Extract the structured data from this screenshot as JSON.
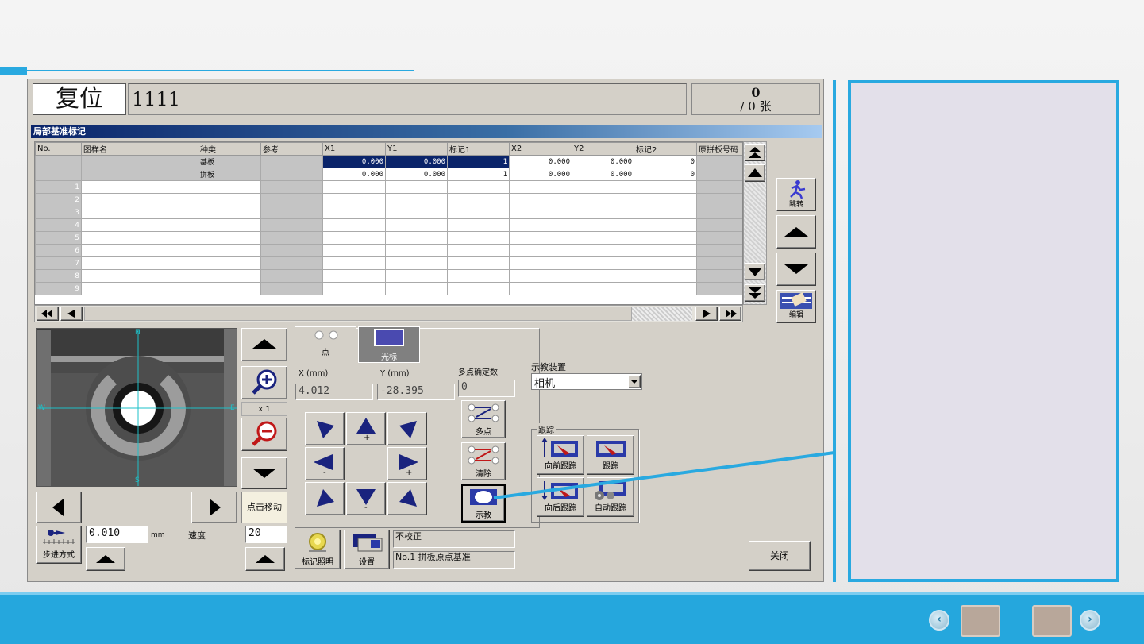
{
  "app": {
    "reset_label": "复位",
    "program_name": "1111",
    "count_top": "0",
    "count_bottom": "/ 0 张",
    "section_title": "局部基准标记"
  },
  "table": {
    "columns": [
      "No.",
      "图样名",
      "种类",
      "参考",
      "X1",
      "Y1",
      "标记1",
      "X2",
      "Y2",
      "标记2",
      "原拼板号码"
    ],
    "rows": [
      {
        "no": "",
        "name": "",
        "kind": "基板",
        "ref": "",
        "x1": "0.000",
        "y1": "0.000",
        "m1": "1",
        "x2": "0.000",
        "y2": "0.000",
        "m2": "0",
        "orig": ""
      },
      {
        "no": "",
        "name": "",
        "kind": "拼板",
        "ref": "",
        "x1": "0.000",
        "y1": "0.000",
        "m1": "1",
        "x2": "0.000",
        "y2": "0.000",
        "m2": "0",
        "orig": ""
      }
    ],
    "empty_row_numbers": [
      "1",
      "2",
      "3",
      "4",
      "5",
      "6",
      "7",
      "8",
      "9"
    ]
  },
  "side_buttons": {
    "jump": "跳转",
    "edit": "编辑"
  },
  "camera": {
    "compass_n": "N",
    "compass_s": "S",
    "compass_w": "W",
    "compass_e": "E",
    "zoom_level": "x 1"
  },
  "controls": {
    "click_move": "点击移动",
    "step_mode": "步进方式",
    "step_value": "0.010",
    "step_unit": "mm",
    "speed_label": "速度",
    "speed_value": "20"
  },
  "tabs": {
    "point": "点",
    "cursor": "光标"
  },
  "coords": {
    "x_label": "X (mm)",
    "y_label": "Y (mm)",
    "multi_label": "多点确定数",
    "x_value": "4.012",
    "y_value": "-28.395",
    "multi_value": "0"
  },
  "jog": {
    "plus": "+",
    "minus": "-"
  },
  "actions": {
    "multi_point": "多点",
    "clear": "清除",
    "teach": "示教",
    "mark_light": "标记照明",
    "settings": "设置",
    "status1": "不校正",
    "status2": "No.1 拼板原点基准",
    "close": "关闭"
  },
  "teach_device": {
    "label": "示教装置",
    "value": "相机"
  },
  "tracking": {
    "group_label": "跟踪",
    "forward": "向前跟踪",
    "track": "跟踪",
    "backward": "向后跟踪",
    "auto": "自动跟踪"
  },
  "colors": {
    "accent": "#29a9e0",
    "selection": "#0a246a",
    "navy_icon": "#1a237e"
  }
}
